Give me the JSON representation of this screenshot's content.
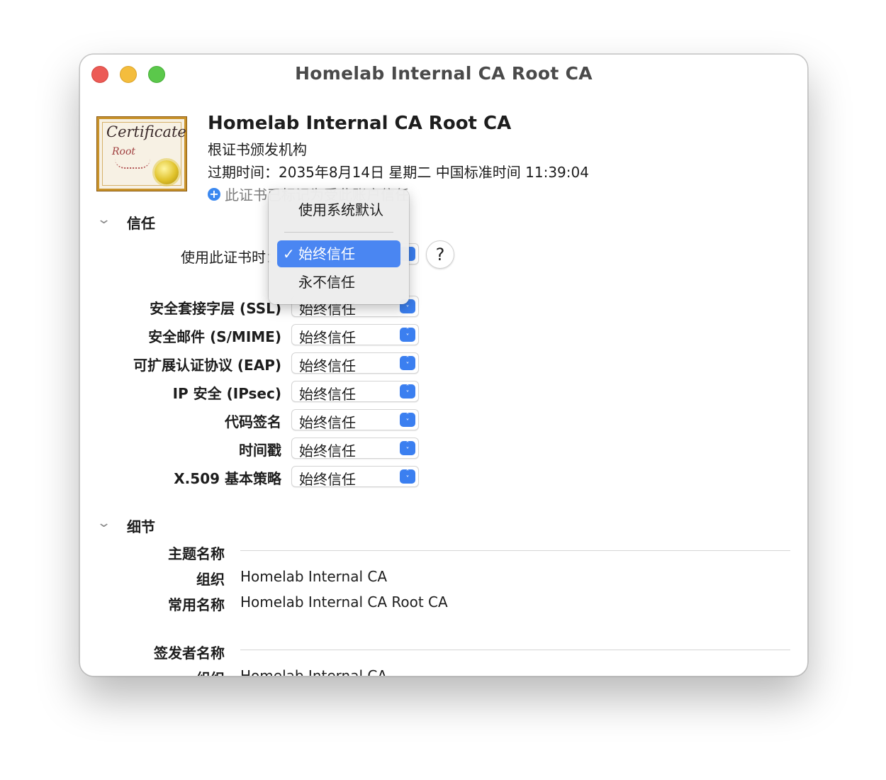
{
  "window": {
    "title": "Homelab Internal CA Root CA",
    "controls": [
      "close-icon",
      "minimize-icon",
      "zoom-icon"
    ],
    "colors": {
      "close": "#ec5b56",
      "minimize": "#f4bd3d",
      "zoom": "#5bc84b",
      "accent": "#3b7ff0"
    }
  },
  "header": {
    "icon_text": "Certificate",
    "icon_subtext": "Root",
    "name": "Homelab Internal CA Root CA",
    "kind": "根证书颁发机构",
    "expiry": "过期时间：2035年8月14日 星期二 中国标准时间 11:39:04",
    "status": "此证书已标记为受此账户信任"
  },
  "trust": {
    "section_title": "信任",
    "when_using_label": "使用此证书时：",
    "help": "?",
    "menu": {
      "items": [
        "使用系统默认",
        "始终信任",
        "永不信任"
      ],
      "selected": "始终信任",
      "check": "✓"
    },
    "rows": [
      {
        "label": "安全套接字层 (SSL)",
        "value": "始终信任"
      },
      {
        "label": "安全邮件 (S/MIME)",
        "value": "始终信任"
      },
      {
        "label": "可扩展认证协议 (EAP)",
        "value": "始终信任"
      },
      {
        "label": "IP 安全 (IPsec)",
        "value": "始终信任"
      },
      {
        "label": "代码签名",
        "value": "始终信任"
      },
      {
        "label": "时间戳",
        "value": "始终信任"
      },
      {
        "label": "X.509 基本策略",
        "value": "始终信任"
      }
    ]
  },
  "details": {
    "section_title": "细节",
    "subject": {
      "title": "主题名称",
      "org_label": "组织",
      "org_value": "Homelab Internal CA",
      "cn_label": "常用名称",
      "cn_value": "Homelab Internal CA Root CA"
    },
    "issuer": {
      "title": "签发者名称",
      "org_label": "组织",
      "org_value": "Homelab Internal CA"
    }
  }
}
